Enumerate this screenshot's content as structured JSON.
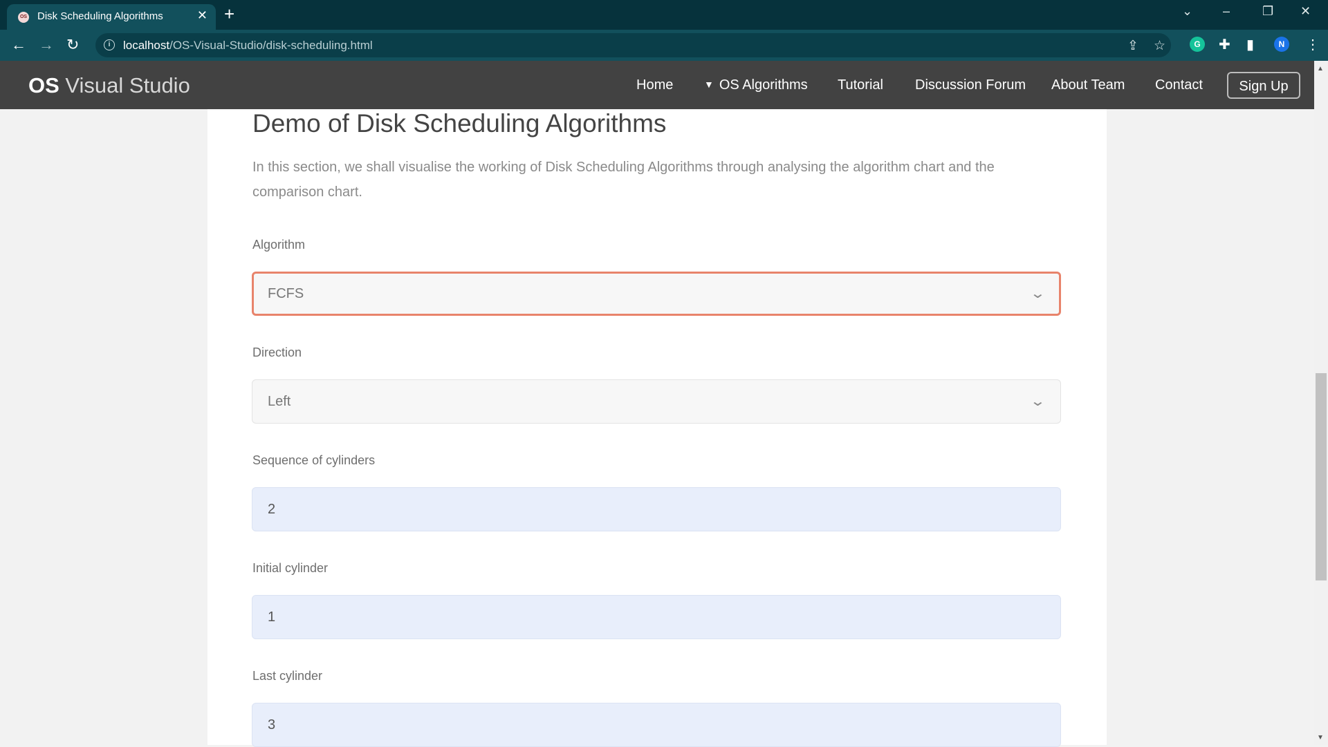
{
  "browser": {
    "tab_title": "Disk Scheduling Algorithms",
    "tab_favicon": "OS",
    "tab_close": "✕",
    "new_tab": "+",
    "url_host": "localhost",
    "url_path": "/OS-Visual-Studio/disk-scheduling.html",
    "profile_initial": "N",
    "grammarly_initial": "G"
  },
  "site": {
    "brand_bold": "OS",
    "brand_light": "Visual Studio",
    "nav": [
      {
        "label": "Home"
      },
      {
        "label": "OS Algorithms"
      },
      {
        "label": "Tutorial"
      },
      {
        "label": "Discussion Forum"
      },
      {
        "label": "About Team"
      },
      {
        "label": "Contact"
      }
    ],
    "signup_label": "Sign Up"
  },
  "main": {
    "title": "Demo of Disk Scheduling Algorithms",
    "intro": "In this section, we shall visualise the working of Disk Scheduling Algorithms through analysing the algorithm chart and the comparison chart.",
    "fields": {
      "algorithm": {
        "label": "Algorithm",
        "value": "FCFS"
      },
      "direction": {
        "label": "Direction",
        "value": "Left"
      },
      "sequence": {
        "label": "Sequence of cylinders",
        "value": "2"
      },
      "initial": {
        "label": "Initial cylinder",
        "value": "1"
      },
      "last": {
        "label": "Last cylinder",
        "value": "3"
      }
    }
  },
  "colors": {
    "focus_border": "#e8836b",
    "header_bg": "#424242",
    "input_bg": "#e8eefb"
  }
}
